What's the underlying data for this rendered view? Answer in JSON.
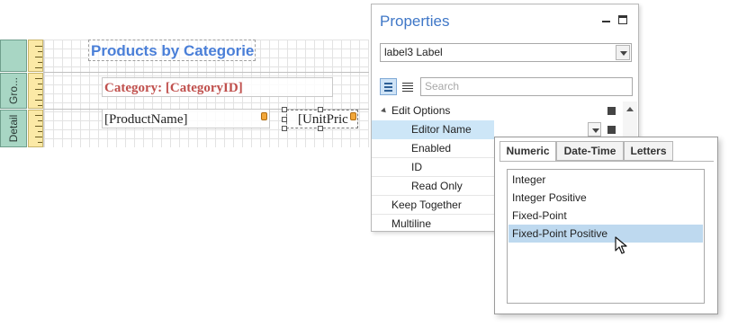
{
  "designer": {
    "bands": [
      {
        "label": "Gro..."
      },
      {
        "label": "Detail"
      }
    ],
    "controls": {
      "title": "Products by Categories",
      "category": "Category: [CategoryID]",
      "product_name": "[ProductName]",
      "unit_price": "[UnitPric"
    }
  },
  "properties": {
    "title": "Properties",
    "object_selector": "label3  Label",
    "search_placeholder": "Search",
    "rows": [
      {
        "name": "Edit Options",
        "kind": "category"
      },
      {
        "name": "Editor Name",
        "kind": "child",
        "selected": true
      },
      {
        "name": "Enabled",
        "kind": "child"
      },
      {
        "name": "ID",
        "kind": "child"
      },
      {
        "name": "Read Only",
        "kind": "child"
      },
      {
        "name": "Keep Together",
        "kind": "top"
      },
      {
        "name": "Multiline",
        "kind": "top"
      }
    ]
  },
  "editor_popup": {
    "tabs": [
      "Numeric",
      "Date-Time",
      "Letters"
    ],
    "active_tab": "Numeric",
    "items": [
      "Integer",
      "Integer Positive",
      "Fixed-Point",
      "Fixed-Point Positive"
    ],
    "selected_item": "Fixed-Point Positive"
  },
  "colors": {
    "accent": "#3f77c7",
    "band_fill": "#a8d6c4",
    "ruler_fill": "#fbe9a6",
    "title_text": "#4a7fd8",
    "category_text": "#c0504d",
    "selection": "#cde6f7"
  },
  "icons": [
    "pin-icon",
    "maximize-icon",
    "categorized-view-icon",
    "alphabetical-view-icon",
    "dropdown-arrow-icon",
    "expander-icon",
    "property-marker-icon",
    "mouse-pointer-icon",
    "data-binding-tag-icon"
  ]
}
